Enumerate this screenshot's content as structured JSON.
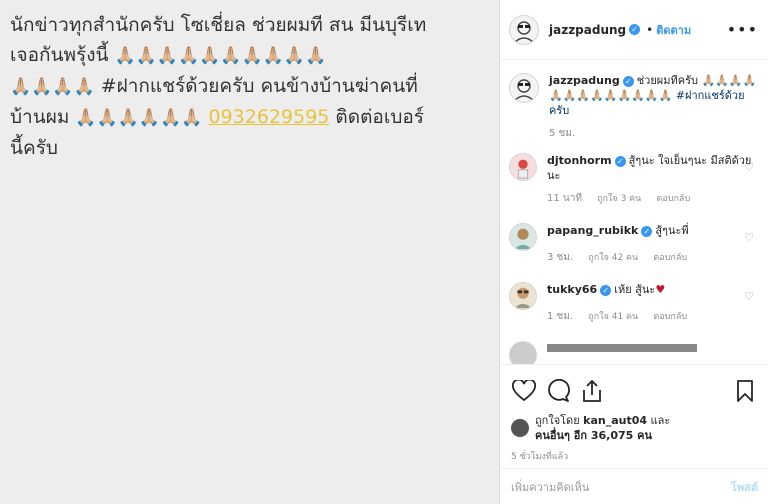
{
  "post_image": {
    "text_line1": "นักข่าวทุกสำนักครับ  โซเชี่ยล ช่วยผมที สน มีนบุรีเท",
    "text_line2_a": "เจอกันพรุ้งนี้ ",
    "pray_row_2": "🙏🏼🙏🏼🙏🏼🙏🏼🙏🏼🙏🏼🙏🏼🙏🏼🙏🏼🙏🏼",
    "pray_row_3": "🙏🏼🙏🏼🙏🏼🙏🏼",
    "text_line3_b": " #ฝากแชร์ด้วยครับ คนข้างบ้านฆ่าคนที่",
    "text_line4_a": "บ้านผม ",
    "pray_row_4": "🙏🏼🙏🏼🙏🏼🙏🏼🙏🏼🙏🏼",
    "phone": "0932629595",
    "text_line4_b": " ติดต่อเบอร์",
    "text_line5": "นี้ครับ"
  },
  "header": {
    "username": "jazzpadung",
    "follow_label": "ติดตาม",
    "more_label": "•••"
  },
  "caption": {
    "username": "jazzpadung",
    "text": "ช่วยผมทีครับ 🙏🏼🙏🏼🙏🏼🙏🏼🙏🏼🙏🏼🙏🏼🙏🏼🙏🏼🙏🏼🙏🏼🙏🏼🙏🏼",
    "hashtag": "#ฝากแชร์ด้วยครับ",
    "time": "5 ชม."
  },
  "comments": [
    {
      "username": "djtonhorm",
      "text": "สู้ๆนะ ใจเย็นๆนะ มีสติด้วยนะ",
      "time": "11 นาที",
      "likes": "ถูกใจ 3 คน",
      "reply": "ตอบกลับ"
    },
    {
      "username": "papang_rubikk",
      "text": "สู้ๆนะพี่",
      "time": "3 ชม.",
      "likes": "ถูกใจ 42 คน",
      "reply": "ตอบกลับ"
    },
    {
      "username": "tukky66",
      "text": "เห้ย สู้นะ",
      "heart": "♥",
      "time": "1 ชม.",
      "likes": "ถูกใจ 41 คน",
      "reply": "ตอบกลับ"
    }
  ],
  "likes": {
    "prefix": "ถูกใจโดย ",
    "user": "kan_aut04",
    "mid": " และ",
    "others": "คนอื่นๆ อีก 36,075 คน"
  },
  "timestamp": "5 ชั่วโมงที่แล้ว",
  "add_comment": {
    "placeholder": "เพิ่มความคิดเห็น",
    "post_label": "โพสต์"
  },
  "colors": {
    "link_blue": "#3897f0",
    "phone_yellow": "#e8c43b",
    "heart_red": "#c0182d"
  }
}
